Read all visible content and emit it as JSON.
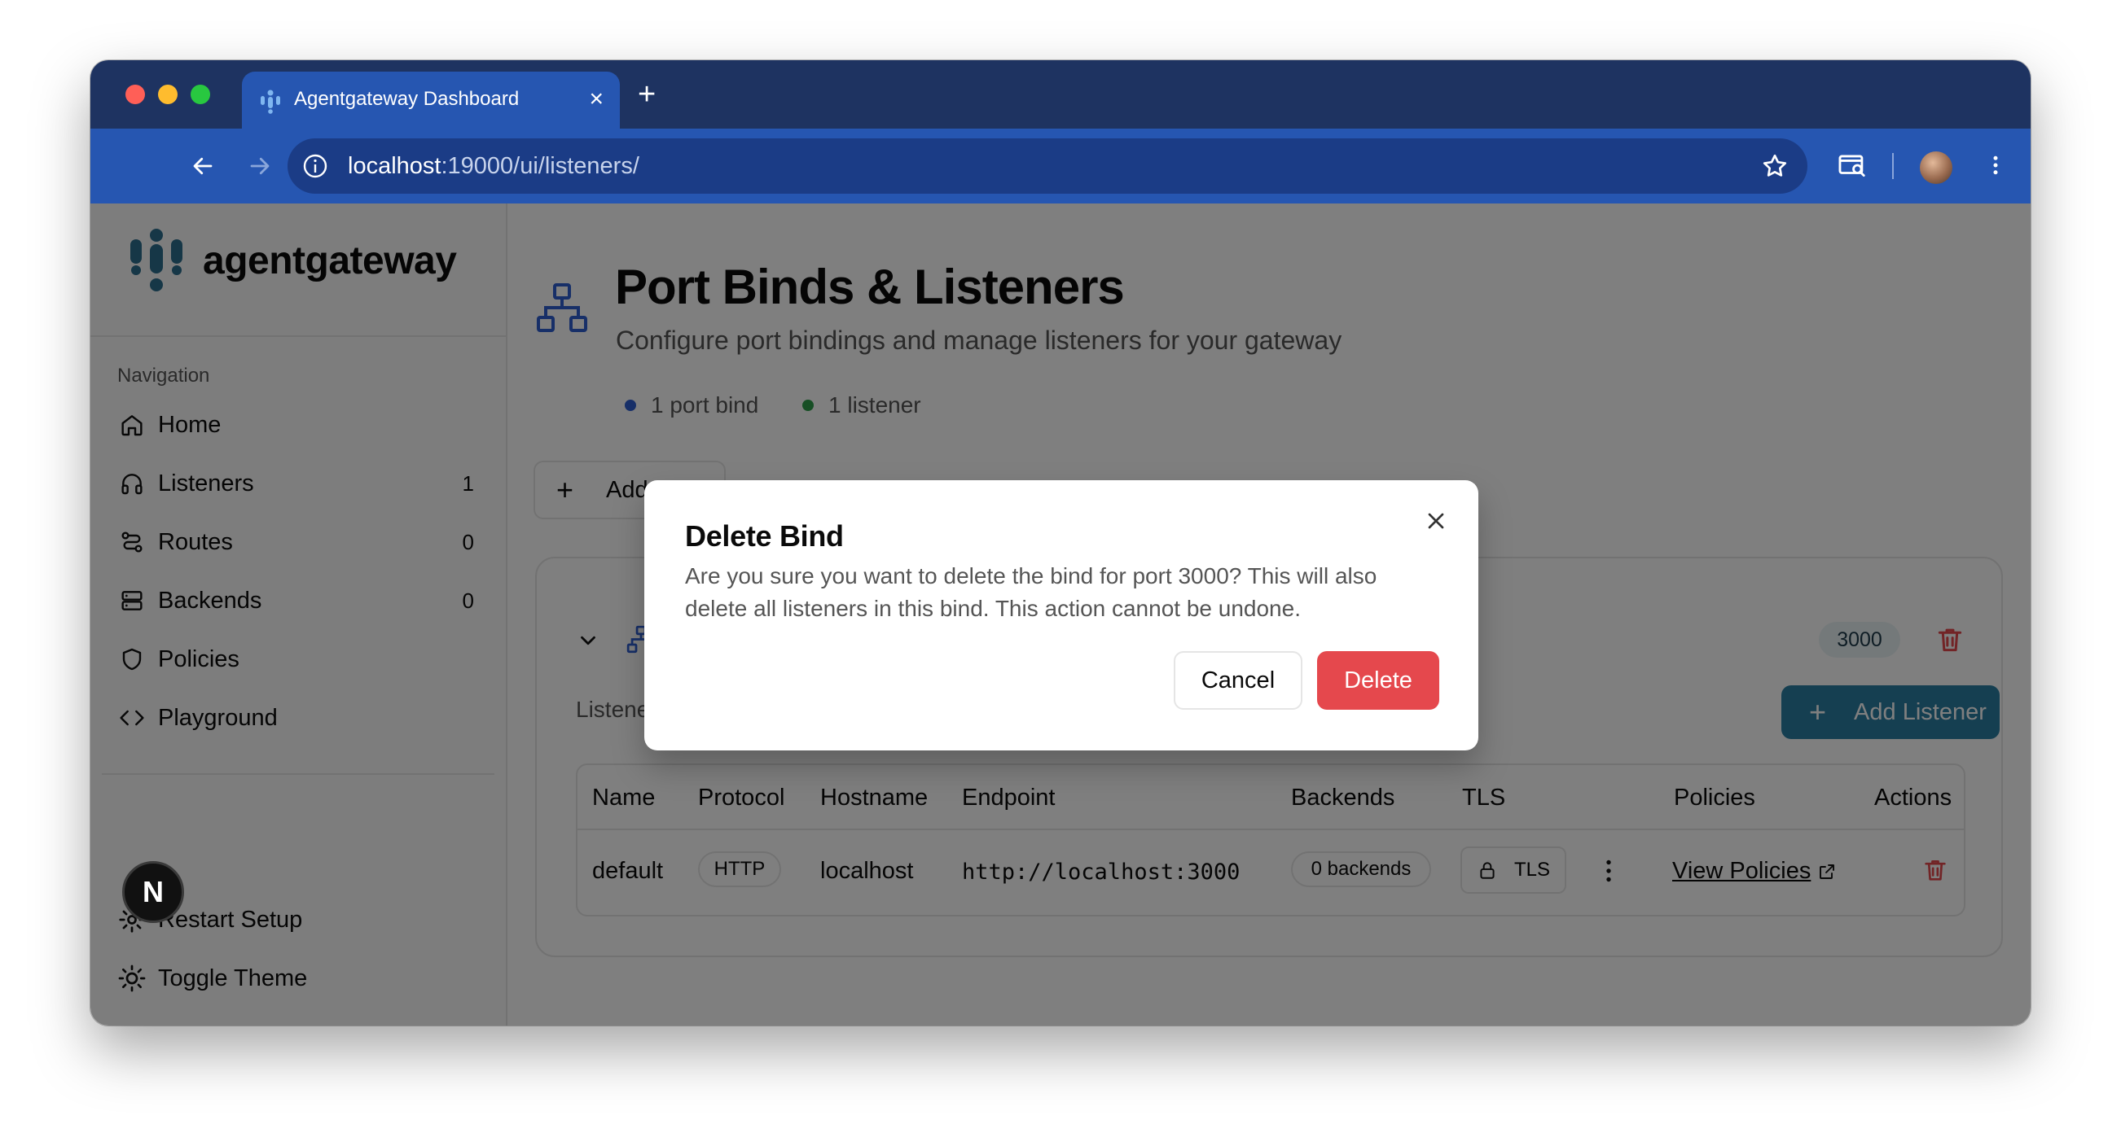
{
  "browser": {
    "tab_title": "Agentgateway Dashboard",
    "url_host": "localhost",
    "url_path": ":19000/ui/listeners/"
  },
  "sidebar": {
    "brand": "agentgateway",
    "nav_heading": "Navigation",
    "items": [
      {
        "label": "Home",
        "icon": "home-icon",
        "count": ""
      },
      {
        "label": "Listeners",
        "icon": "headphones-icon",
        "count": "1"
      },
      {
        "label": "Routes",
        "icon": "route-icon",
        "count": "0"
      },
      {
        "label": "Backends",
        "icon": "server-icon",
        "count": "0"
      },
      {
        "label": "Policies",
        "icon": "shield-icon",
        "count": ""
      },
      {
        "label": "Playground",
        "icon": "code-icon",
        "count": ""
      }
    ],
    "bottom": {
      "restart": "Restart Setup",
      "toggle_theme": "Toggle Theme"
    }
  },
  "main": {
    "title": "Port Binds & Listeners",
    "subtitle": "Configure port bindings and manage listeners for your gateway",
    "stats": {
      "port_binds": "1 port bind",
      "listeners": "1 listener"
    },
    "add_bind_label": "Add Bind",
    "bind": {
      "port": "3000",
      "listeners_label": "Listeners",
      "add_listener_label": "Add Listener",
      "table": {
        "headers": [
          "Name",
          "Protocol",
          "Hostname",
          "Endpoint",
          "Backends",
          "TLS",
          "Policies",
          "Actions"
        ],
        "rows": [
          {
            "name": "default",
            "protocol": "HTTP",
            "hostname": "localhost",
            "endpoint": "http://localhost:3000",
            "backends": "0 backends",
            "tls": "TLS",
            "policies_link": "View Policies"
          }
        ]
      }
    }
  },
  "dialog": {
    "title": "Delete Bind",
    "message": "Are you sure you want to delete the bind for port 3000? This will also delete all listeners in this bind. This action cannot be undone.",
    "cancel_label": "Cancel",
    "delete_label": "Delete"
  },
  "dev_badge": "N",
  "colors": {
    "tab_bar": "#1e3361",
    "toolbar": "#2656b1",
    "accent": "#2a7ea3",
    "danger": "#e5484d",
    "port_dot": "#2f5fd0",
    "listener_dot": "#2e9e4a"
  }
}
